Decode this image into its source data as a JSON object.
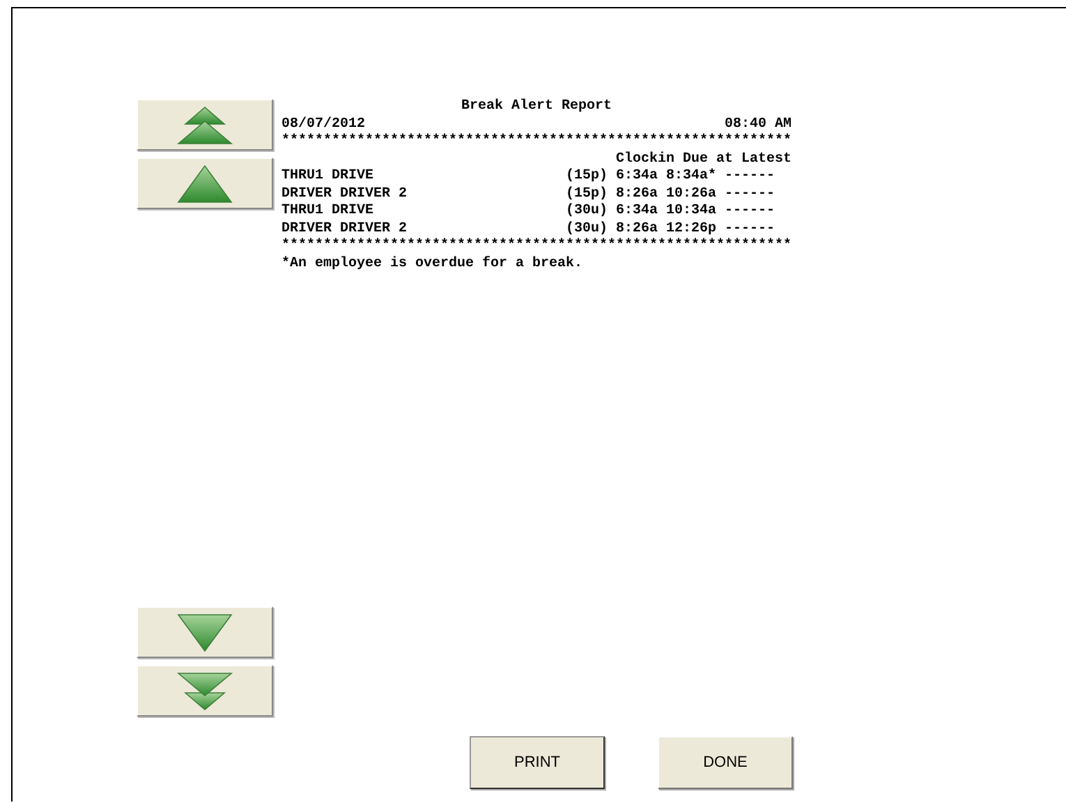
{
  "nav_buttons": [
    {
      "kind": "double-up"
    },
    {
      "kind": "up"
    },
    {
      "kind": "down"
    },
    {
      "kind": "double-down"
    }
  ],
  "report": {
    "title": "Break Alert Report",
    "date": "08/07/2012",
    "time": "08:40 AM",
    "separator": "*************************************************************",
    "column_header": "Clockin Due at Latest",
    "rows": [
      {
        "name": "THRU1 DRIVE",
        "break": "(15p)",
        "clockin": "6:34a",
        "due": "8:34a*",
        "latest": "------"
      },
      {
        "name": "DRIVER DRIVER 2",
        "break": "(15p)",
        "clockin": "8:26a",
        "due": "10:26a",
        "latest": "------"
      },
      {
        "name": "THRU1 DRIVE",
        "break": "(30u)",
        "clockin": "6:34a",
        "due": "10:34a",
        "latest": "------"
      },
      {
        "name": "DRIVER DRIVER 2",
        "break": "(30u)",
        "clockin": "8:26a",
        "due": "12:26p",
        "latest": "------"
      }
    ],
    "footnote": "*An employee is overdue for a break."
  },
  "buttons": [
    "PRINT",
    "DONE"
  ]
}
